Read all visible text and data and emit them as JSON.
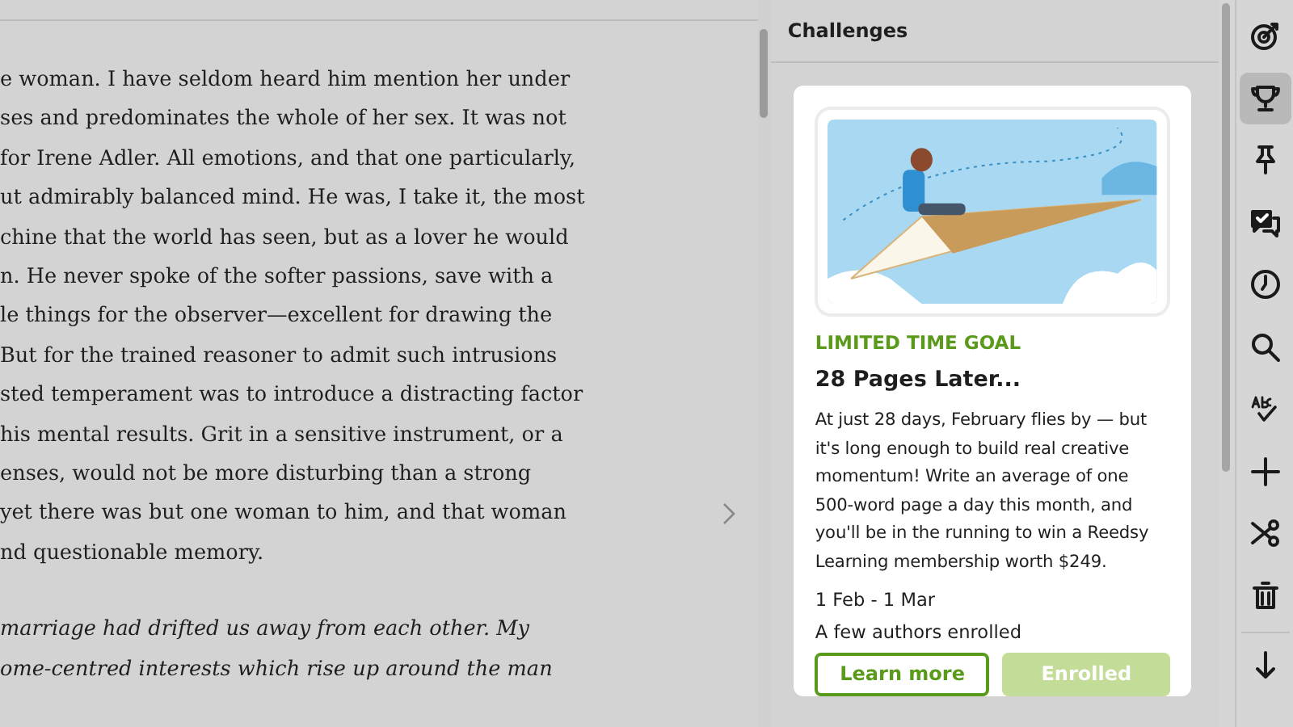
{
  "editor": {
    "paragraphs": [
      {
        "italic": false,
        "lines": [
          "e woman. I have seldom heard him mention her under",
          "ses and predominates the whole of her sex. It was not",
          "for Irene Adler. All emotions, and that one particularly,",
          "ut admirably balanced mind. He was, I take it, the most",
          "chine that the world has seen, but as a lover he would",
          "n. He never spoke of the softer passions, save with a",
          "le things for the observer—excellent for drawing the",
          "But for the trained reasoner to admit such intrusions",
          "sted temperament was to introduce a distracting factor",
          "his mental results. Grit in a sensitive instrument, or a",
          "enses, would not be more disturbing than a strong",
          "yet there was but one woman to him, and that woman",
          "nd questionable memory."
        ]
      },
      {
        "italic": true,
        "lines": [
          "marriage had drifted us away from each other. My",
          "ome-centred interests which rise up around the man"
        ]
      }
    ]
  },
  "panel": {
    "title": "Challenges",
    "card": {
      "tag": "LIMITED TIME GOAL",
      "title": "28 Pages Later...",
      "description": "At just 28 days, February flies by — but it's long enough to build real creative momentum! Write an average of one 500-word page a day this month, and you'll be in the running to win a Reedsy Learning membership worth $249.",
      "dates": "1 Feb - 1 Mar",
      "enrolled_count": "A few authors enrolled",
      "buttons": [
        {
          "label": "Learn more",
          "kind": "outline",
          "disabled": false
        },
        {
          "label": "Enrolled",
          "kind": "filled",
          "disabled": true
        }
      ]
    }
  },
  "toolbar": [
    {
      "kind": "target",
      "selected": false
    },
    {
      "kind": "trophy",
      "selected": true
    },
    {
      "kind": "pin",
      "selected": false
    },
    {
      "kind": "chat",
      "selected": false
    },
    {
      "kind": "clock",
      "selected": false
    },
    {
      "kind": "search",
      "selected": false
    },
    {
      "kind": "spell",
      "selected": false
    },
    {
      "kind": "plus",
      "selected": false
    },
    {
      "kind": "scissors",
      "selected": false
    },
    {
      "kind": "trash",
      "selected": false
    },
    {
      "kind": "divider"
    },
    {
      "kind": "down",
      "selected": false
    }
  ]
}
